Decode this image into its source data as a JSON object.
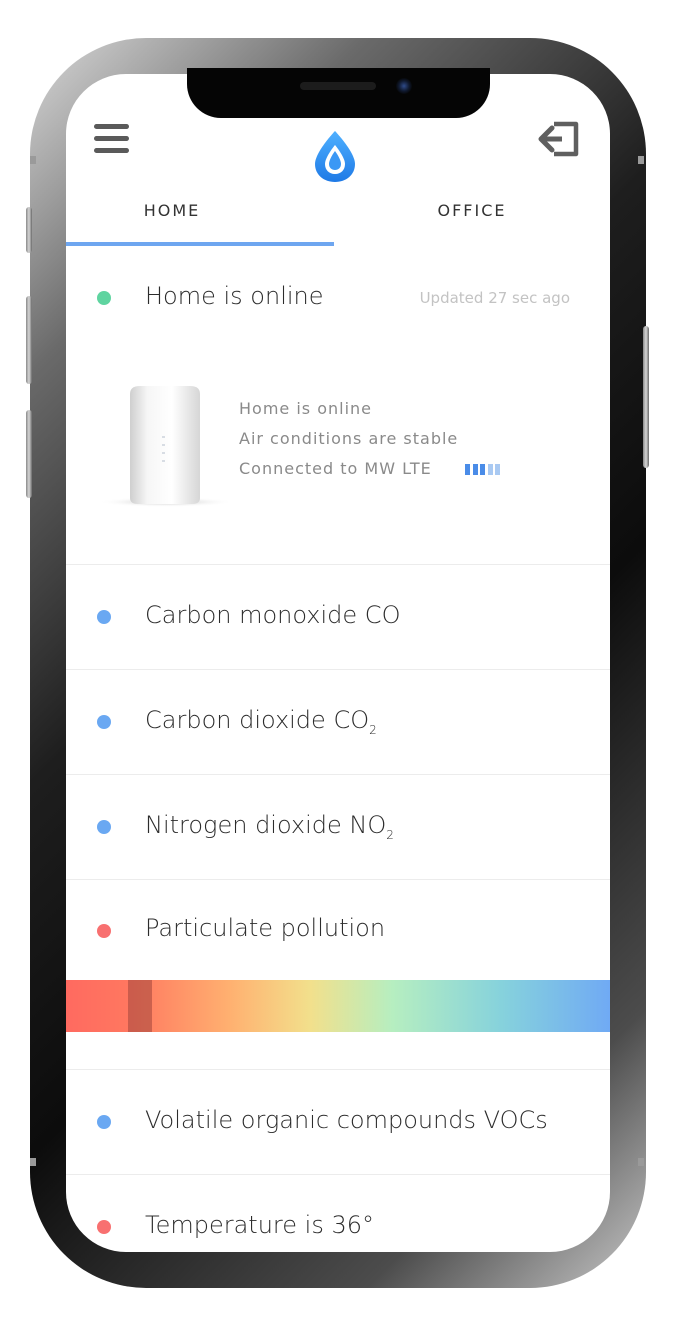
{
  "header": {
    "menu_icon": "hamburger-menu-icon",
    "logo_icon": "water-drop-icon",
    "logout_icon": "logout-icon"
  },
  "tabs": [
    {
      "label": "HOME",
      "active": true
    },
    {
      "label": "OFFICE",
      "active": false
    }
  ],
  "status": {
    "title": "Home is online",
    "updated": "Updated 27 sec ago",
    "color": "#5fd4a0"
  },
  "device": {
    "lines": [
      "Home is online",
      "Air conditions are stable",
      "Connected to MW LTE"
    ],
    "signal_bars_total": 5,
    "signal_bars_strong": 3,
    "signal_color": "#4a8ce8"
  },
  "sensors": [
    {
      "label": "Carbon monoxide CO",
      "sub": "",
      "color": "#6aa8f2"
    },
    {
      "label": "Carbon dioxide CO",
      "sub": "2",
      "color": "#6aa8f2"
    },
    {
      "label": "Nitrogen dioxide NO",
      "sub": "2",
      "color": "#6aa8f2"
    },
    {
      "label": "Particulate pollution",
      "sub": "",
      "color": "#f87070"
    },
    {
      "label": "Volatile organic compounds VOCs",
      "sub": "",
      "color": "#6aa8f2"
    },
    {
      "label": "Temperature is 36°",
      "sub": "",
      "color": "#f87070"
    }
  ],
  "pollution_scale": {
    "marker_position": 0.13,
    "colors": [
      "#ff6a60",
      "#ffb070",
      "#f2e08c",
      "#b6eec0",
      "#70aaf4"
    ]
  }
}
